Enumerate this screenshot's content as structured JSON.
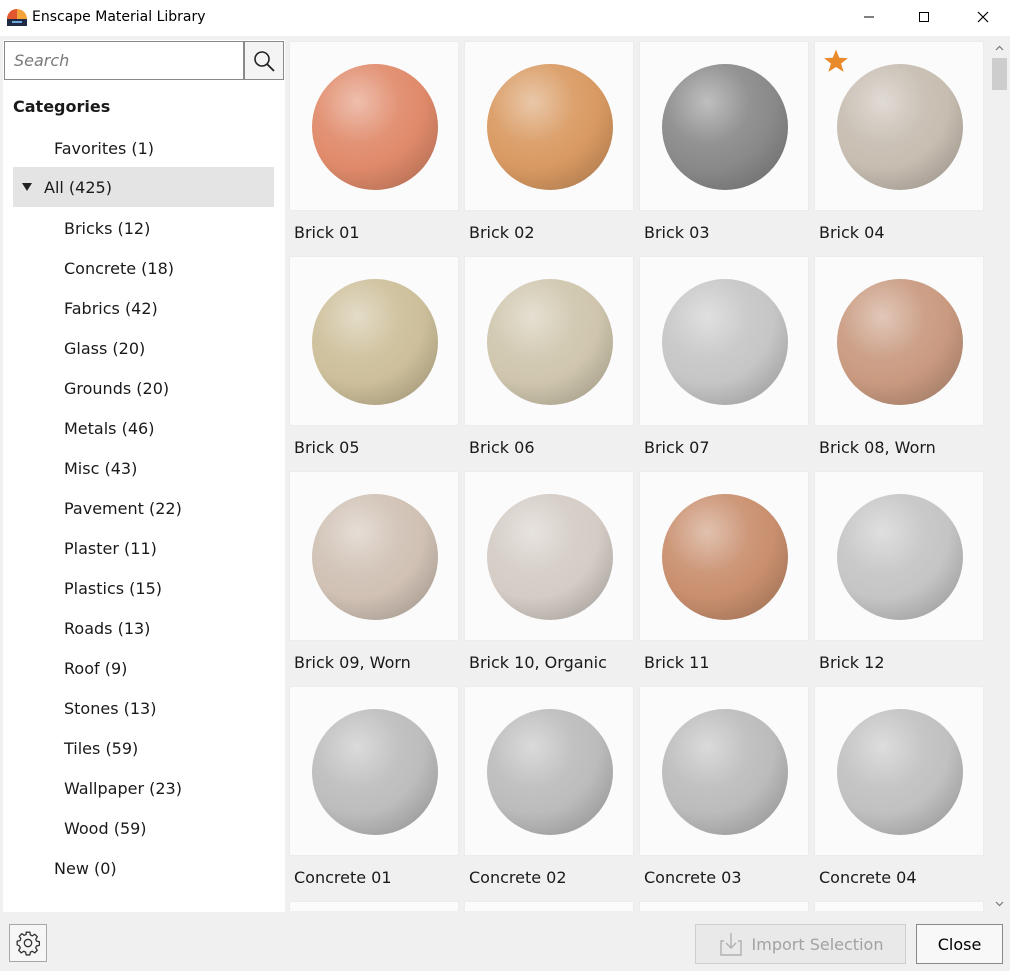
{
  "window": {
    "title": "Enscape Material Library",
    "controls": {
      "minimize_icon": "minimize-icon",
      "maximize_icon": "maximize-icon",
      "close_icon": "close-icon"
    }
  },
  "search": {
    "placeholder": "Search",
    "value": "",
    "icon": "search-icon"
  },
  "sidebar": {
    "heading": "Categories",
    "top_items": [
      {
        "label": "Favorites (1)"
      }
    ],
    "all": {
      "label": "All (425)",
      "expanded": true,
      "selected": true
    },
    "sub_items": [
      {
        "label": "Bricks (12)"
      },
      {
        "label": "Concrete (18)"
      },
      {
        "label": "Fabrics (42)"
      },
      {
        "label": "Glass (20)"
      },
      {
        "label": "Grounds (20)"
      },
      {
        "label": "Metals (46)"
      },
      {
        "label": "Misc (43)"
      },
      {
        "label": "Pavement (22)"
      },
      {
        "label": "Plaster (11)"
      },
      {
        "label": "Plastics (15)"
      },
      {
        "label": "Roads (13)"
      },
      {
        "label": "Roof (9)"
      },
      {
        "label": "Stones (13)"
      },
      {
        "label": "Tiles (59)"
      },
      {
        "label": "Wallpaper (23)"
      },
      {
        "label": "Wood (59)"
      }
    ],
    "bottom_items": [
      {
        "label": "New (0)"
      }
    ]
  },
  "materials": [
    {
      "name": "Brick 01",
      "color": "#e08a6a",
      "favorite": false
    },
    {
      "name": "Brick 02",
      "color": "#d99a62",
      "favorite": false
    },
    {
      "name": "Brick 03",
      "color": "#8a8a8a",
      "favorite": false
    },
    {
      "name": "Brick 04",
      "color": "#c7bdb1",
      "favorite": true
    },
    {
      "name": "Brick 05",
      "color": "#cdbf9a",
      "favorite": false
    },
    {
      "name": "Brick 06",
      "color": "#cfc6ad",
      "favorite": false
    },
    {
      "name": "Brick 07",
      "color": "#c6c6c6",
      "favorite": false
    },
    {
      "name": "Brick 08, Worn",
      "color": "#c99a80",
      "favorite": false
    },
    {
      "name": "Brick 09, Worn",
      "color": "#d0c1b4",
      "favorite": false
    },
    {
      "name": "Brick 10, Organic",
      "color": "#d4ccc5",
      "favorite": false
    },
    {
      "name": "Brick 11",
      "color": "#c98f6e",
      "favorite": false
    },
    {
      "name": "Brick 12",
      "color": "#c5c5c5",
      "favorite": false
    },
    {
      "name": "Concrete 01",
      "color": "#bdbdbd",
      "favorite": false
    },
    {
      "name": "Concrete 02",
      "color": "#bcbcbc",
      "favorite": false
    },
    {
      "name": "Concrete 03",
      "color": "#bcbcbc",
      "favorite": false
    },
    {
      "name": "Concrete 04",
      "color": "#c1c1c1",
      "favorite": false
    }
  ],
  "star_color": "#e8892a",
  "footer": {
    "settings_icon": "gear-icon",
    "import_label": "Import Selection",
    "import_icon": "import-icon",
    "import_enabled": false,
    "close_label": "Close"
  }
}
